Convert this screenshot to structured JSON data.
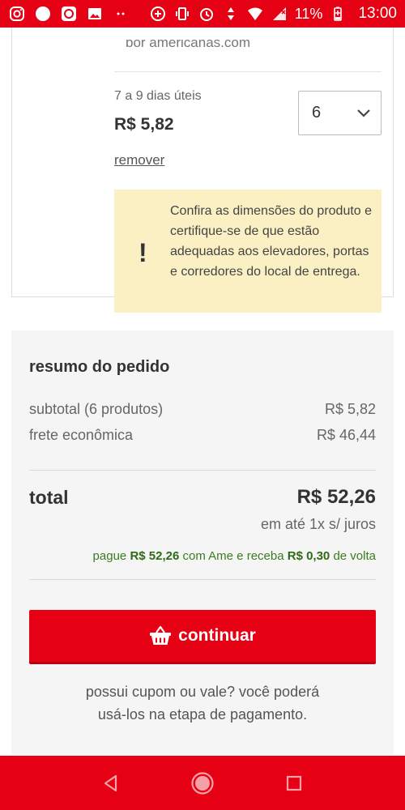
{
  "status_bar": {
    "battery": "11%",
    "time": "13:00",
    "left_icons": [
      "instagram-icon",
      "circle-icon",
      "app-icon",
      "image-icon",
      "more-dots-icon"
    ],
    "right_icons": [
      "data-saver-icon",
      "vibrate-icon",
      "alarm-icon",
      "data-arrows-icon",
      "wifi-icon",
      "signal-icon",
      "battery-icon"
    ]
  },
  "item": {
    "cut_text": "por americanas.com",
    "delivery": "7 a 9 dias úteis",
    "price": "R$ 5,82",
    "quantity": "6",
    "remove_label": "remover",
    "warning_symbol": "!",
    "warning_text": "Confira as dimensões do produto e certifique-se de que estão adequadas aos elevadores, portas e corredores do local de entrega."
  },
  "summary": {
    "title": "resumo do pedido",
    "subtotal_label": "subtotal (6 produtos)",
    "subtotal_value": "R$ 5,82",
    "shipping_label": "frete econômica",
    "shipping_value": "R$ 46,44",
    "total_label": "total",
    "total_value": "R$ 52,26",
    "installments": "em até 1x s/ juros",
    "ame_prefix": "pague",
    "ame_amount": "R$ 52,26",
    "ame_middle": "com Ame e receba",
    "ame_cashback": "R$ 0,30",
    "ame_suffix": "de volta",
    "continue_label": "continuar",
    "coupon_line1": "possui cupom ou vale? você poderá",
    "coupon_line2": "usá-los na etapa de pagamento."
  },
  "colors": {
    "brand_red": "#e60014",
    "warning_bg": "#fbf0c4",
    "ame_green": "#3a7d1f"
  }
}
